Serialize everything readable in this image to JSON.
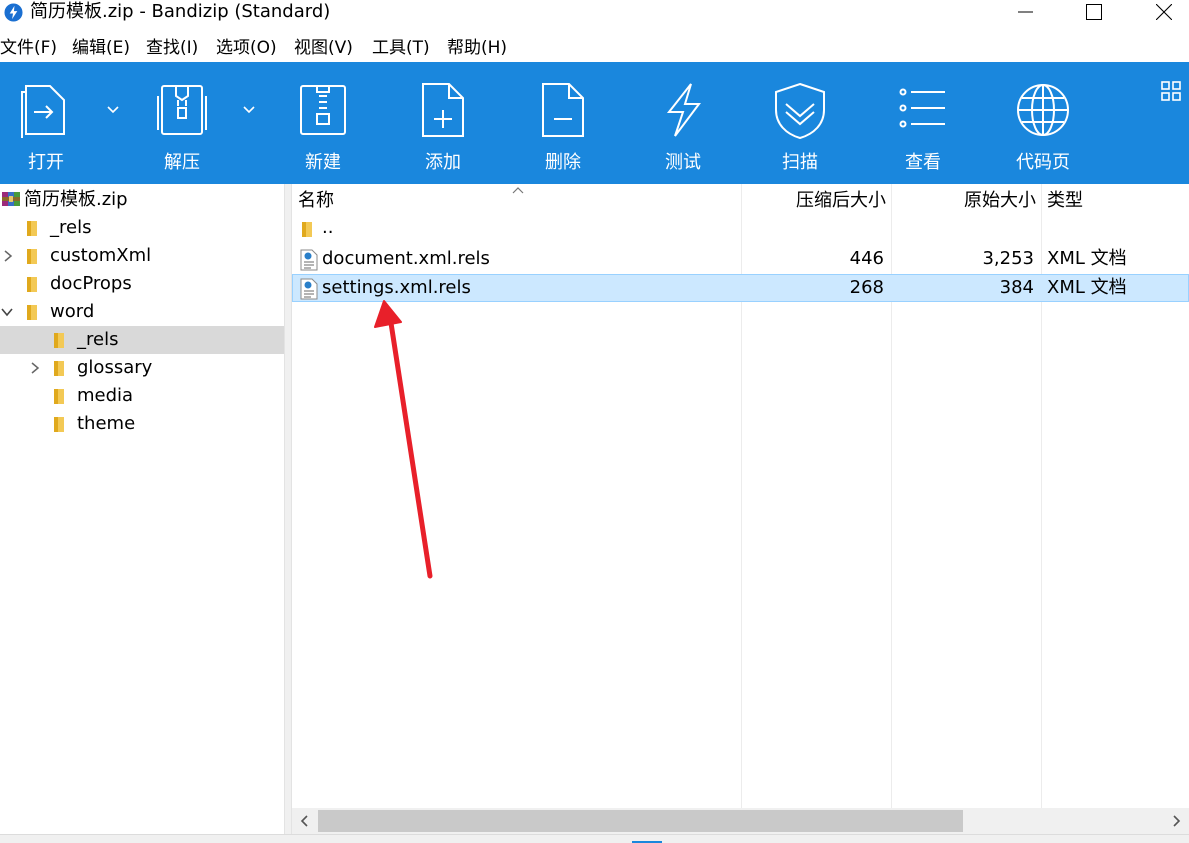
{
  "window": {
    "title": "简历模板.zip - Bandizip (Standard)"
  },
  "menu": [
    "文件(F)",
    "编辑(E)",
    "查找(I)",
    "选项(O)",
    "视图(V)",
    "工具(T)",
    "帮助(H)"
  ],
  "toolbar": {
    "items": [
      {
        "label": "打开",
        "icon": "open-icon",
        "dropdown": true
      },
      {
        "label": "解压",
        "icon": "extract-icon",
        "dropdown": true
      },
      {
        "label": "新建",
        "icon": "new-archive-icon"
      },
      {
        "label": "添加",
        "icon": "add-file-icon"
      },
      {
        "label": "删除",
        "icon": "delete-file-icon"
      },
      {
        "label": "测试",
        "icon": "lightning-icon"
      },
      {
        "label": "扫描",
        "icon": "shield-icon"
      },
      {
        "label": "查看",
        "icon": "list-icon"
      },
      {
        "label": "代码页",
        "icon": "globe-icon"
      }
    ]
  },
  "tree": {
    "root": "简历模板.zip",
    "items": [
      {
        "label": "_rels",
        "expandable": false,
        "expanded": false,
        "selected": false
      },
      {
        "label": "customXml",
        "expandable": true,
        "expanded": false,
        "selected": false
      },
      {
        "label": "docProps",
        "expandable": false,
        "expanded": false,
        "selected": false
      },
      {
        "label": "word",
        "expandable": true,
        "expanded": true,
        "selected": false
      },
      {
        "label": "_rels",
        "expandable": false,
        "expanded": false,
        "selected": true
      },
      {
        "label": "glossary",
        "expandable": true,
        "expanded": false,
        "selected": false
      },
      {
        "label": "media",
        "expandable": false,
        "expanded": false,
        "selected": false
      },
      {
        "label": "theme",
        "expandable": false,
        "expanded": false,
        "selected": false
      }
    ]
  },
  "list": {
    "columns": [
      "名称",
      "压缩后大小",
      "原始大小",
      "类型"
    ],
    "rows": [
      {
        "name": "..",
        "compressed": "",
        "original": "",
        "type": "",
        "kind": "parent-folder",
        "selected": false
      },
      {
        "name": "document.xml.rels",
        "compressed": "446",
        "original": "3,253",
        "type": "XML 文档",
        "kind": "xml-file",
        "selected": false
      },
      {
        "name": "settings.xml.rels",
        "compressed": "268",
        "original": "384",
        "type": "XML 文档",
        "kind": "xml-file",
        "selected": true
      }
    ]
  },
  "colors": {
    "toolbar": "#1a87dd",
    "selection": "#cce8ff",
    "tree_selection": "#d9d9d9",
    "annotation_arrow": "#e8202a"
  }
}
